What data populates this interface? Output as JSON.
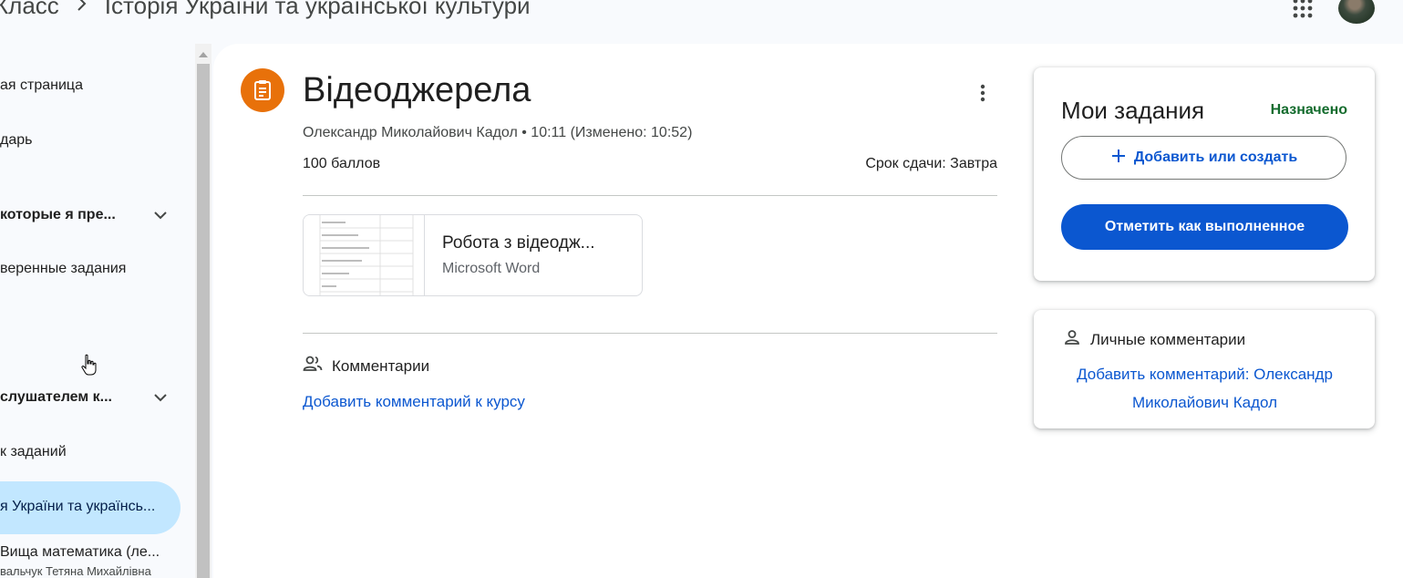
{
  "topbar": {
    "app_name": "Класс",
    "separator": ">",
    "course": "Історія України та української культури"
  },
  "sidebar": {
    "items": [
      {
        "label": "ая страница"
      },
      {
        "label": "дарь"
      },
      {
        "label": "которые я пре..."
      },
      {
        "label": "веренные задания"
      },
      {
        "label": "слушателем к..."
      },
      {
        "label": "к заданий"
      },
      {
        "label": "я України та українсь..."
      },
      {
        "label": "Вища математика (ле..."
      }
    ],
    "last_item_sub": "вальчук Тетяна Михайлівна"
  },
  "assignment": {
    "title": "Відеоджерела",
    "meta": "Олександр Миколайович Кадол • 10:11 (Изменено: 10:52)",
    "points": "100 баллов",
    "due": "Срок сдачи: Завтра",
    "attachment": {
      "title": "Робота з відеодж...",
      "type": "Microsoft Word"
    },
    "comments_label": "Комментарии",
    "add_course_comment": "Добавить комментарий к курсу"
  },
  "my_work": {
    "title": "Мои задания",
    "status": "Назначено",
    "add_button": "Добавить или создать",
    "done_button": "Отметить как выполненное"
  },
  "private_comments": {
    "title": "Личные комментарии",
    "add_label": "Добавить комментарий: Олександр Миколайович Кадол"
  },
  "colors": {
    "accent": "#0b57d0",
    "assignment_icon": "#e8710a",
    "status_green": "#146c2e",
    "active_nav": "#c2e7ff"
  },
  "icons": [
    "chevron-right-icon",
    "apps-grid-icon",
    "avatar",
    "chevron-down-icon",
    "assignment-icon",
    "more-vert-icon",
    "people-icon",
    "plus-icon",
    "person-icon",
    "hand-cursor-icon"
  ]
}
